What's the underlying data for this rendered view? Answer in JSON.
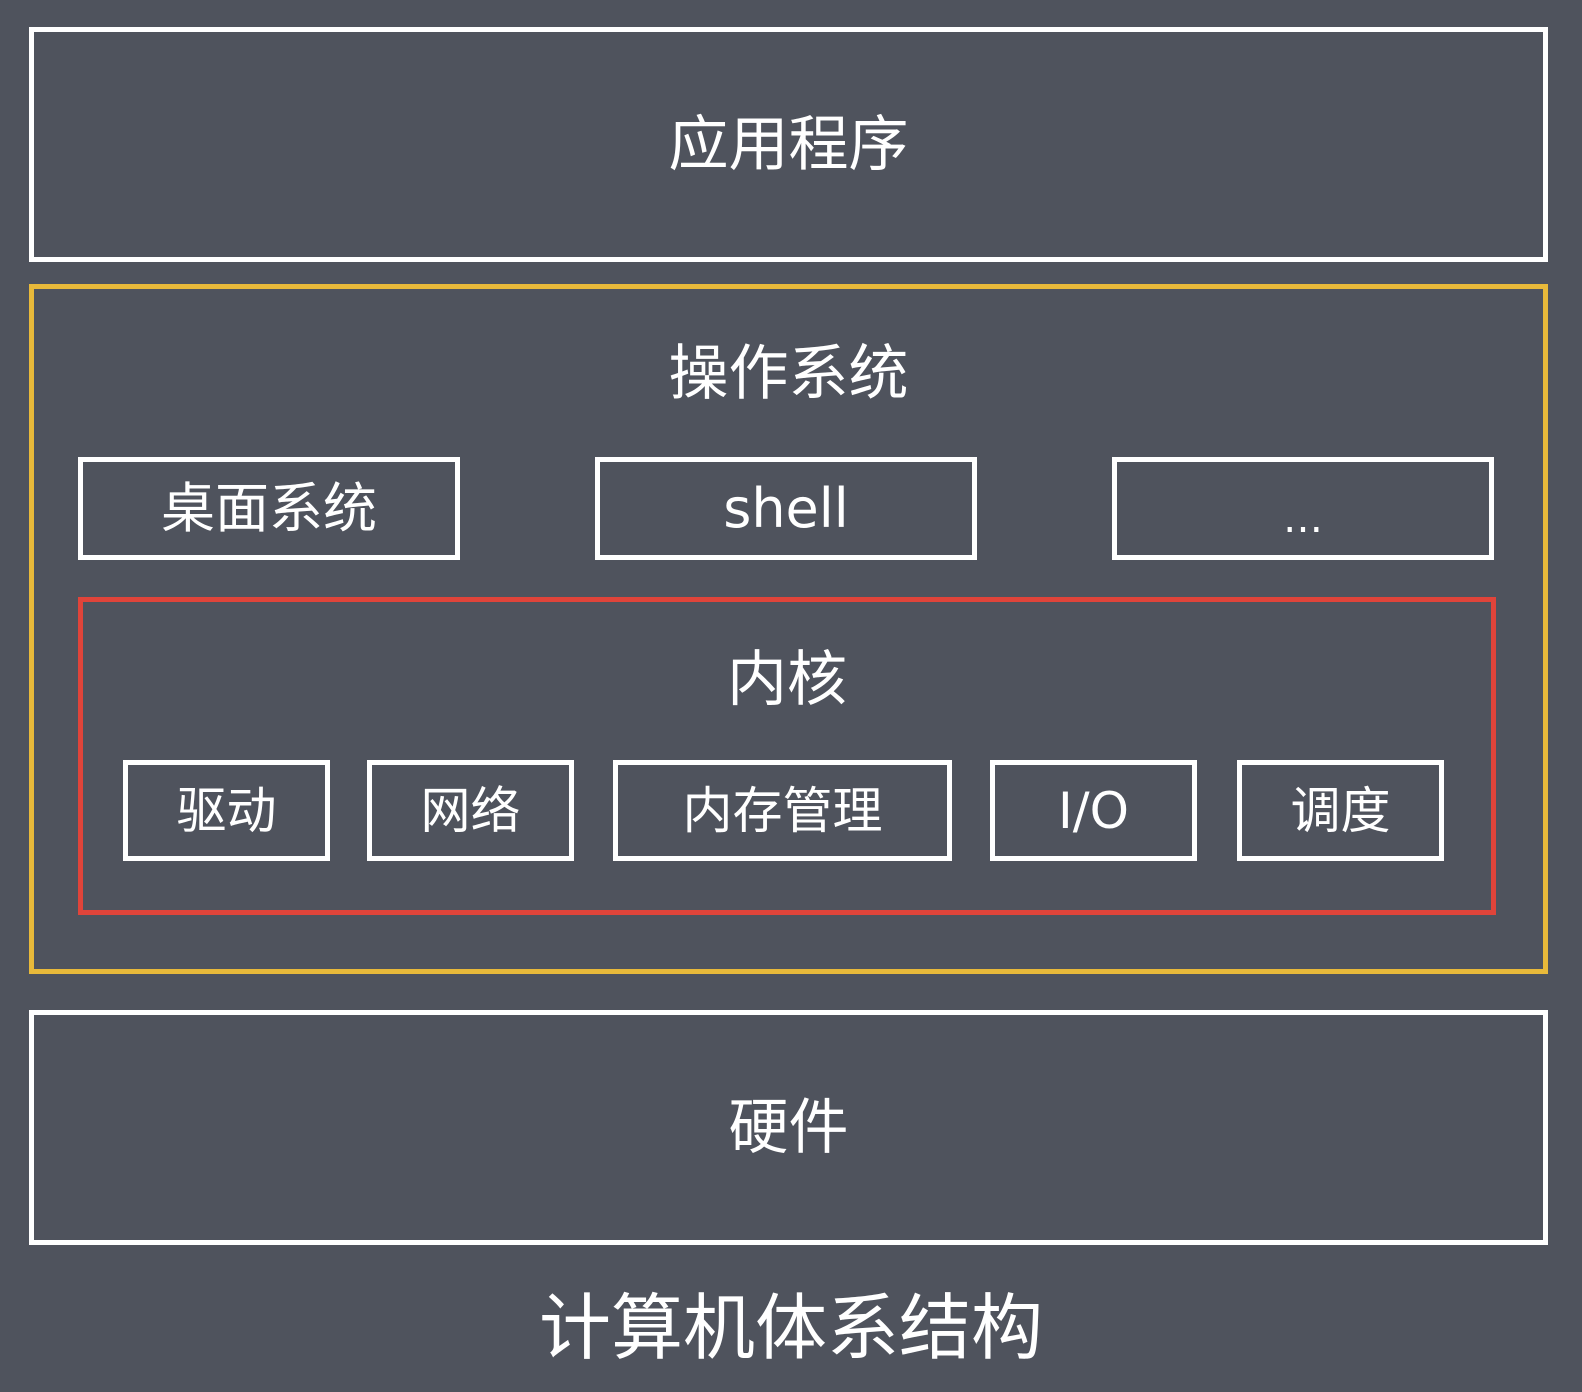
{
  "layers": {
    "applications": {
      "label": "应用程序"
    },
    "operating_system": {
      "label": "操作系统",
      "components": [
        {
          "label": "桌面系统"
        },
        {
          "label": "shell"
        },
        {
          "label": "…"
        }
      ],
      "kernel": {
        "label": "内核",
        "modules": [
          {
            "label": "驱动"
          },
          {
            "label": "网络"
          },
          {
            "label": "内存管理"
          },
          {
            "label": "I/O"
          },
          {
            "label": "调度"
          }
        ]
      }
    },
    "hardware": {
      "label": "硬件"
    }
  },
  "caption": "计算机体系结构",
  "colors": {
    "background": "#4f535d",
    "box_border": "#ffffff",
    "os_border": "#e8b93a",
    "kernel_border": "#e0443a",
    "text": "#ffffff"
  }
}
